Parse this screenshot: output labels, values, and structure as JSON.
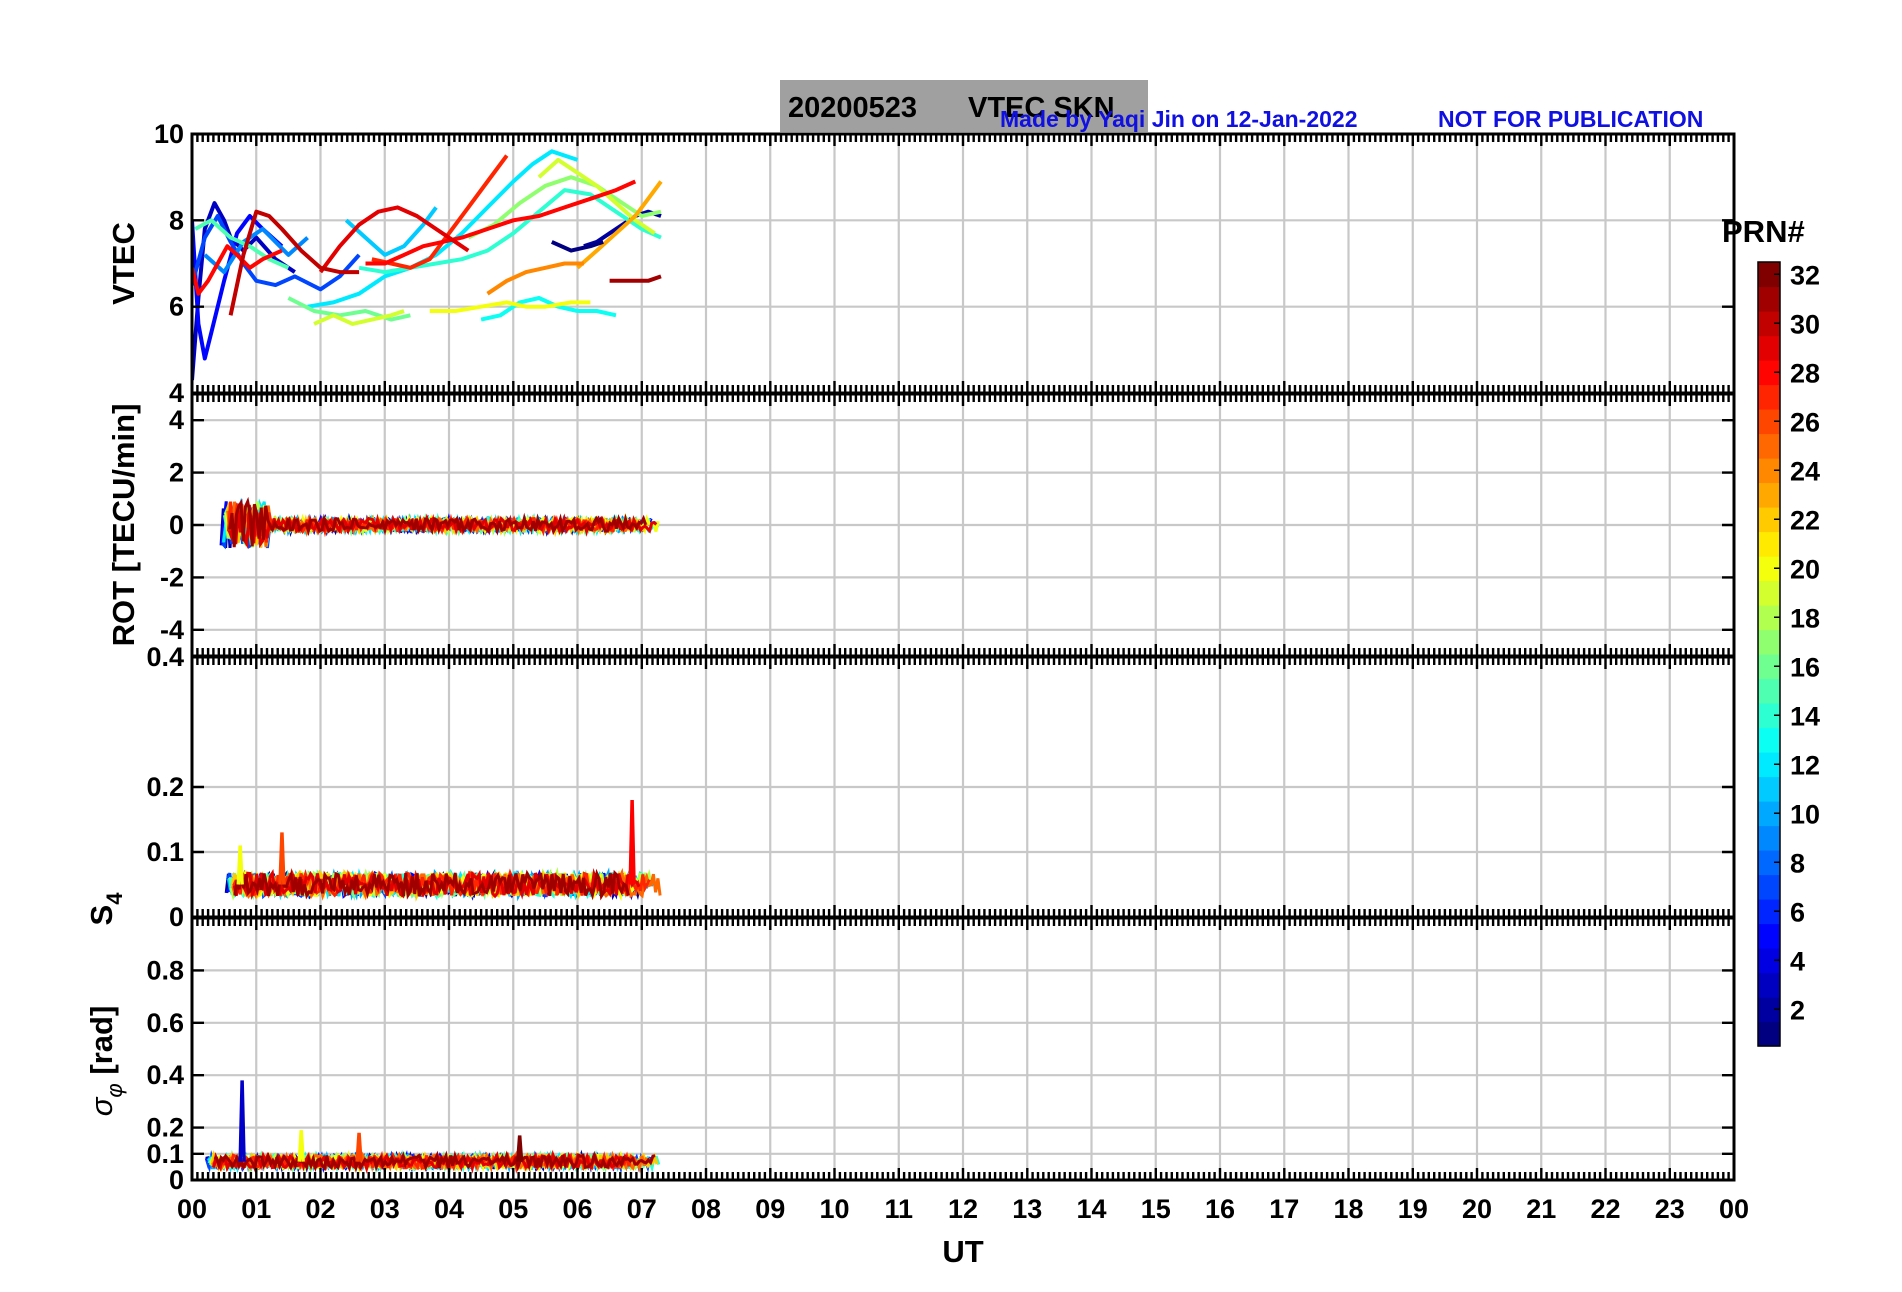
{
  "header": {
    "date": "20200523",
    "title": "VTEC  SKN",
    "credit": "Made by Yaqi Jin on 12-Jan-2022",
    "notice": "NOT FOR PUBLICATION"
  },
  "colors": {
    "title_box": "#a0a0a0",
    "credit_text": "#1010e0",
    "grid": "#c8c8c8",
    "colormap": "jet"
  },
  "chart_data": [
    {
      "id": "vtec",
      "type": "line",
      "ylabel": "VTEC",
      "ylim": [
        4,
        10
      ],
      "yticks": [
        "4",
        "6",
        "8",
        "10"
      ],
      "ytick_values": [
        4,
        6,
        8,
        10
      ],
      "grid": true,
      "series": [
        {
          "prn": 3,
          "x": [
            0.0,
            0.1,
            0.2,
            0.35,
            0.5,
            0.6,
            0.8,
            1.0,
            1.3,
            1.6
          ],
          "y": [
            4.3,
            6.2,
            7.8,
            8.4,
            8.0,
            7.6,
            7.3,
            7.6,
            7.1,
            6.8
          ]
        },
        {
          "prn": 5,
          "x": [
            0.0,
            0.1,
            0.2,
            0.3,
            0.5,
            0.7,
            0.9,
            1.1,
            1.4
          ],
          "y": [
            8.0,
            5.6,
            4.8,
            5.4,
            6.6,
            7.7,
            8.1,
            7.8,
            7.4
          ]
        },
        {
          "prn": 7,
          "x": [
            0.0,
            0.2,
            0.4,
            0.6,
            0.8,
            1.0,
            1.3,
            1.6,
            2.0,
            2.3,
            2.6
          ],
          "y": [
            6.5,
            7.6,
            8.1,
            7.5,
            7.0,
            6.6,
            6.5,
            6.7,
            6.4,
            6.7,
            7.2
          ]
        },
        {
          "prn": 9,
          "x": [
            0.2,
            0.5,
            0.8,
            1.1,
            1.5,
            1.8
          ],
          "y": [
            7.2,
            6.8,
            7.5,
            7.8,
            7.2,
            7.6
          ]
        },
        {
          "prn": 2,
          "x": [
            6.1,
            6.3,
            6.5,
            6.7,
            6.9,
            7.1,
            7.3
          ],
          "y": [
            7.4,
            7.5,
            7.7,
            7.9,
            8.1,
            8.2,
            8.1
          ]
        },
        {
          "prn": 11,
          "x": [
            2.4,
            2.7,
            3.0,
            3.3,
            3.6,
            3.8
          ],
          "y": [
            8.0,
            7.6,
            7.2,
            7.4,
            7.9,
            8.3
          ]
        },
        {
          "prn": 13,
          "x": [
            4.5,
            4.8,
            5.1,
            5.4,
            5.7,
            6.0,
            6.3,
            6.6
          ],
          "y": [
            5.7,
            5.8,
            6.1,
            6.2,
            6.0,
            5.9,
            5.9,
            5.8
          ]
        },
        {
          "prn": 12,
          "x": [
            1.8,
            2.2,
            2.6,
            3.0,
            3.4,
            3.8,
            4.2,
            4.6,
            5.0,
            5.3,
            5.6,
            6.0
          ],
          "y": [
            6.0,
            6.1,
            6.3,
            6.7,
            6.9,
            7.2,
            7.7,
            8.3,
            8.9,
            9.3,
            9.6,
            9.4
          ]
        },
        {
          "prn": 14,
          "x": [
            2.6,
            3.0,
            3.4,
            3.8,
            4.2,
            4.6,
            5.0,
            5.4,
            5.8,
            6.2,
            6.6,
            7.0,
            7.3
          ],
          "y": [
            6.9,
            6.8,
            6.9,
            7.0,
            7.1,
            7.3,
            7.7,
            8.2,
            8.7,
            8.6,
            8.2,
            7.8,
            7.6
          ]
        },
        {
          "prn": 15,
          "x": [
            0.05,
            0.3,
            0.6,
            0.9,
            1.2,
            1.5
          ],
          "y": [
            7.8,
            8.0,
            7.6,
            7.4,
            7.1,
            6.9
          ]
        },
        {
          "prn": 16,
          "x": [
            1.5,
            1.9,
            2.3,
            2.7,
            3.1,
            3.4
          ],
          "y": [
            6.2,
            5.9,
            5.8,
            5.9,
            5.7,
            5.8
          ]
        },
        {
          "prn": 17,
          "x": [
            4.3,
            4.7,
            5.1,
            5.5,
            5.9,
            6.3,
            6.7,
            7.0,
            7.3
          ],
          "y": [
            7.6,
            7.9,
            8.4,
            8.8,
            9.0,
            8.8,
            8.4,
            8.1,
            8.2
          ]
        },
        {
          "prn": 19,
          "x": [
            1.9,
            2.2,
            2.5,
            2.8,
            3.1,
            3.3
          ],
          "y": [
            5.6,
            5.8,
            5.6,
            5.7,
            5.8,
            5.9
          ]
        },
        {
          "prn": 20,
          "x": [
            3.7,
            4.1,
            4.5,
            4.9,
            5.2,
            5.5,
            5.9,
            6.2
          ],
          "y": [
            5.9,
            5.9,
            6.0,
            6.1,
            6.0,
            6.0,
            6.1,
            6.1
          ]
        },
        {
          "prn": 19,
          "x": [
            5.4,
            5.7,
            6.0,
            6.3,
            6.6,
            6.9,
            7.2
          ],
          "y": [
            9.0,
            9.4,
            9.1,
            8.8,
            8.4,
            8.0,
            7.7
          ]
        },
        {
          "prn": 23,
          "x": [
            6.0,
            6.3,
            6.6,
            6.9,
            7.1,
            7.3
          ],
          "y": [
            6.9,
            7.3,
            7.7,
            8.1,
            8.5,
            8.9
          ]
        },
        {
          "prn": 24,
          "x": [
            4.6,
            4.9,
            5.2,
            5.5,
            5.8,
            6.1
          ],
          "y": [
            6.3,
            6.6,
            6.8,
            6.9,
            7.0,
            7.0
          ]
        },
        {
          "prn": 27,
          "x": [
            2.8,
            3.1,
            3.4,
            3.7,
            4.0,
            4.3,
            4.6,
            4.9
          ],
          "y": [
            7.1,
            7.0,
            6.9,
            7.1,
            7.7,
            8.3,
            8.9,
            9.5
          ]
        },
        {
          "prn": 28,
          "x": [
            0.0,
            0.1,
            0.25,
            0.4,
            0.55,
            0.7,
            0.9,
            1.1,
            1.4
          ],
          "y": [
            6.9,
            6.3,
            6.6,
            7.0,
            7.4,
            7.2,
            6.9,
            7.1,
            7.3
          ]
        },
        {
          "prn": 28,
          "x": [
            2.7,
            3.0,
            3.3,
            3.6,
            3.9,
            4.2,
            4.6,
            5.0,
            5.4,
            5.8,
            6.2,
            6.6,
            6.9
          ],
          "y": [
            7.0,
            7.0,
            7.2,
            7.4,
            7.5,
            7.6,
            7.8,
            8.0,
            8.1,
            8.3,
            8.5,
            8.7,
            8.9
          ]
        },
        {
          "prn": 29,
          "x": [
            2.0,
            2.3,
            2.6,
            2.9,
            3.2,
            3.5,
            3.8,
            4.1,
            4.3
          ],
          "y": [
            6.8,
            7.4,
            7.9,
            8.2,
            8.3,
            8.1,
            7.8,
            7.5,
            7.3
          ]
        },
        {
          "prn": 30,
          "x": [
            0.6,
            0.8,
            1.0,
            1.2,
            1.4,
            1.7,
            2.0,
            2.3,
            2.6
          ],
          "y": [
            5.8,
            7.2,
            8.2,
            8.1,
            7.8,
            7.3,
            6.9,
            6.8,
            6.8
          ]
        },
        {
          "prn": 31,
          "x": [
            6.5,
            6.7,
            6.9,
            7.1,
            7.3
          ],
          "y": [
            6.6,
            6.6,
            6.6,
            6.6,
            6.7
          ]
        },
        {
          "prn": 1,
          "x": [
            5.6,
            5.9,
            6.2,
            6.4
          ],
          "y": [
            7.5,
            7.3,
            7.4,
            7.5
          ]
        }
      ]
    },
    {
      "id": "rot",
      "type": "line",
      "ylabel": "ROT [TECU/min]",
      "ylim": [
        -5,
        5
      ],
      "yticks": [
        "-4",
        "-2",
        "0",
        "2",
        "4"
      ],
      "ytick_values": [
        -4,
        -2,
        0,
        2,
        4
      ],
      "grid": true,
      "x_range": [
        0,
        7.3
      ],
      "y_center": 0,
      "note": "Dense noise band around 0, amplitude up to ~1.5 near 00-01 UT and ~0.4 afterward"
    },
    {
      "id": "s4",
      "type": "line",
      "ylabel": "S4",
      "ylim": [
        0,
        0.4
      ],
      "yticks": [
        "0",
        "0.1",
        "0.2",
        "0.4"
      ],
      "ytick_values": [
        0,
        0.1,
        0.2,
        0.4
      ],
      "grid": true,
      "x_range": [
        0,
        7.3
      ],
      "baseline": 0.05,
      "spikes": [
        {
          "x": 6.85,
          "y": 0.18
        },
        {
          "x": 0.75,
          "y": 0.11
        },
        {
          "x": 1.4,
          "y": 0.13
        }
      ]
    },
    {
      "id": "sigphi",
      "type": "line",
      "ylabel": "σφ [rad]",
      "ylim": [
        0,
        1.0
      ],
      "yticks": [
        "0",
        "0.1",
        "0.2",
        "0.4",
        "0.6",
        "0.8"
      ],
      "ytick_values": [
        0,
        0.1,
        0.2,
        0.4,
        0.6,
        0.8
      ],
      "grid": true,
      "x_range": [
        0,
        7.3
      ],
      "baseline": 0.07,
      "spikes": [
        {
          "x": 0.78,
          "y": 0.38
        },
        {
          "x": 1.7,
          "y": 0.19
        },
        {
          "x": 2.6,
          "y": 0.18
        },
        {
          "x": 5.1,
          "y": 0.17
        }
      ]
    }
  ],
  "xaxis": {
    "label": "UT",
    "range": [
      0,
      24
    ],
    "ticks": [
      "00",
      "01",
      "02",
      "03",
      "04",
      "05",
      "06",
      "07",
      "08",
      "09",
      "10",
      "11",
      "12",
      "13",
      "14",
      "15",
      "16",
      "17",
      "18",
      "19",
      "20",
      "21",
      "22",
      "23",
      "00"
    ]
  },
  "colorbar": {
    "label": "PRN#",
    "range": [
      1,
      32
    ],
    "ticks": [
      "2",
      "4",
      "6",
      "8",
      "10",
      "12",
      "14",
      "16",
      "18",
      "20",
      "22",
      "24",
      "26",
      "28",
      "30",
      "32"
    ],
    "tick_values": [
      2,
      4,
      6,
      8,
      10,
      12,
      14,
      16,
      18,
      20,
      22,
      24,
      26,
      28,
      30,
      32
    ]
  }
}
